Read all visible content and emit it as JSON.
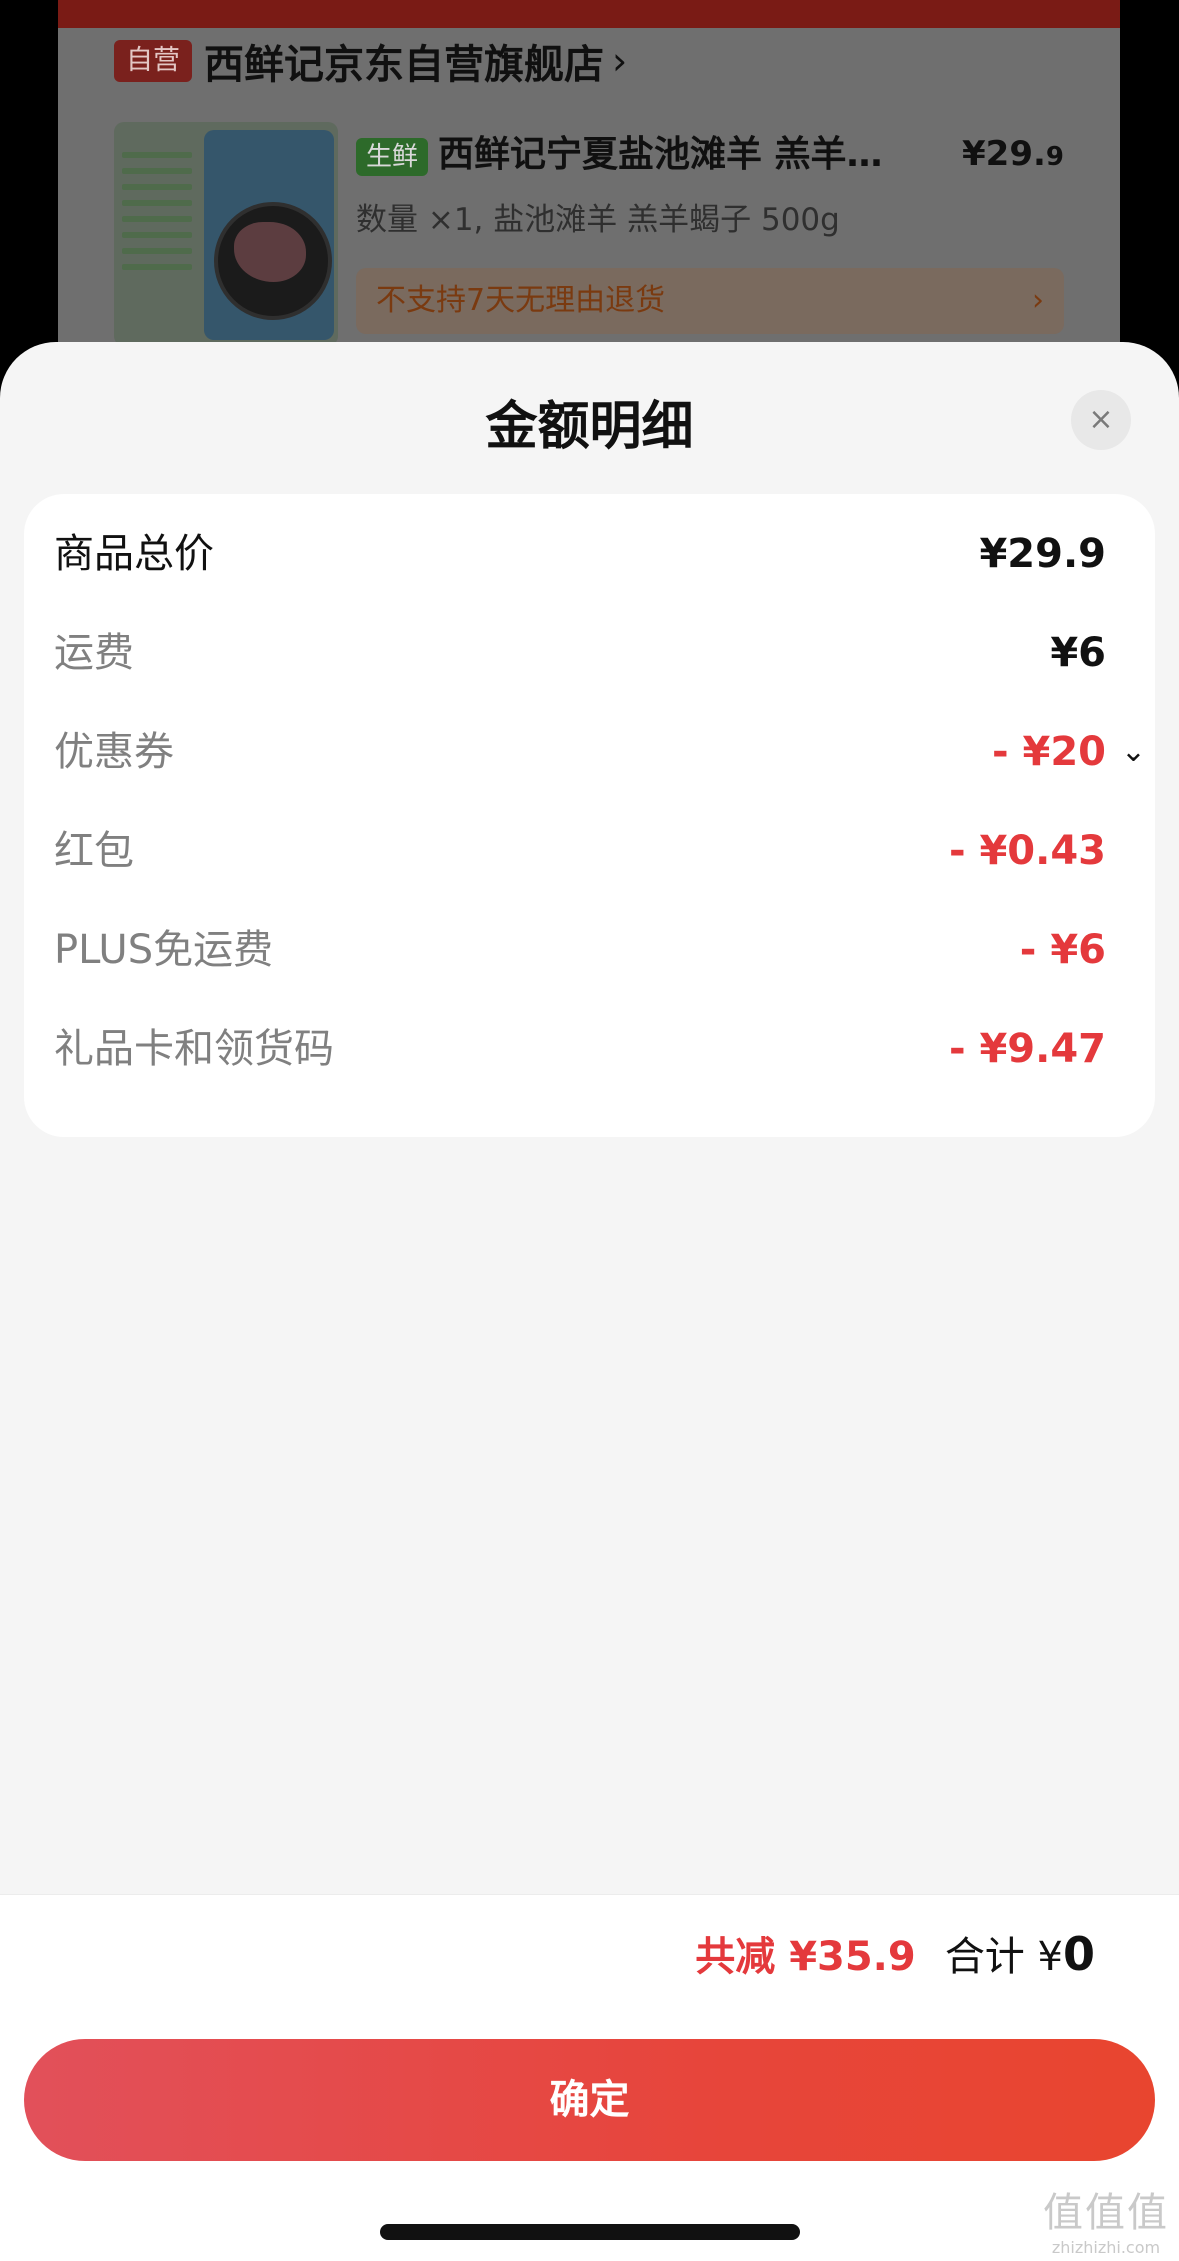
{
  "background_order": {
    "self_badge": "自营",
    "store_name": "西鲜记京东自营旗舰店",
    "store_chevron": "›",
    "fresh_tag": "生鲜",
    "product_title": "西鲜记宁夏盐池滩羊 羔羊…",
    "product_price_main": "¥29.",
    "product_price_decimal": "9",
    "product_spec": "数量 ×1, 盐池滩羊 羔羊蝎子 500g",
    "return_notice": "不支持7天无理由退货",
    "return_chevron": "›"
  },
  "sheet": {
    "title": "金额明细",
    "close_icon": "×",
    "rows": [
      {
        "label": "商品总价",
        "value": "¥29.9"
      },
      {
        "label": "运费",
        "value": "¥6"
      },
      {
        "label": "优惠券",
        "value": "- ¥20",
        "dropdown": "⌄"
      },
      {
        "label": "红包",
        "value": "- ¥0.43"
      },
      {
        "label": "PLUS免运费",
        "value": "- ¥6"
      },
      {
        "label": "礼品卡和领货码",
        "value": "- ¥9.47"
      }
    ],
    "summary": {
      "total_reduction": "共减 ¥35.9",
      "total_label": "合计 ¥",
      "total_value": "0"
    },
    "confirm_label": "确定"
  },
  "watermark": {
    "logo_text": "值值值",
    "site": "zhizhizhi.com"
  },
  "colors": {
    "accent_red": "#e4393c",
    "sheet_bg": "#f5f5f5"
  }
}
